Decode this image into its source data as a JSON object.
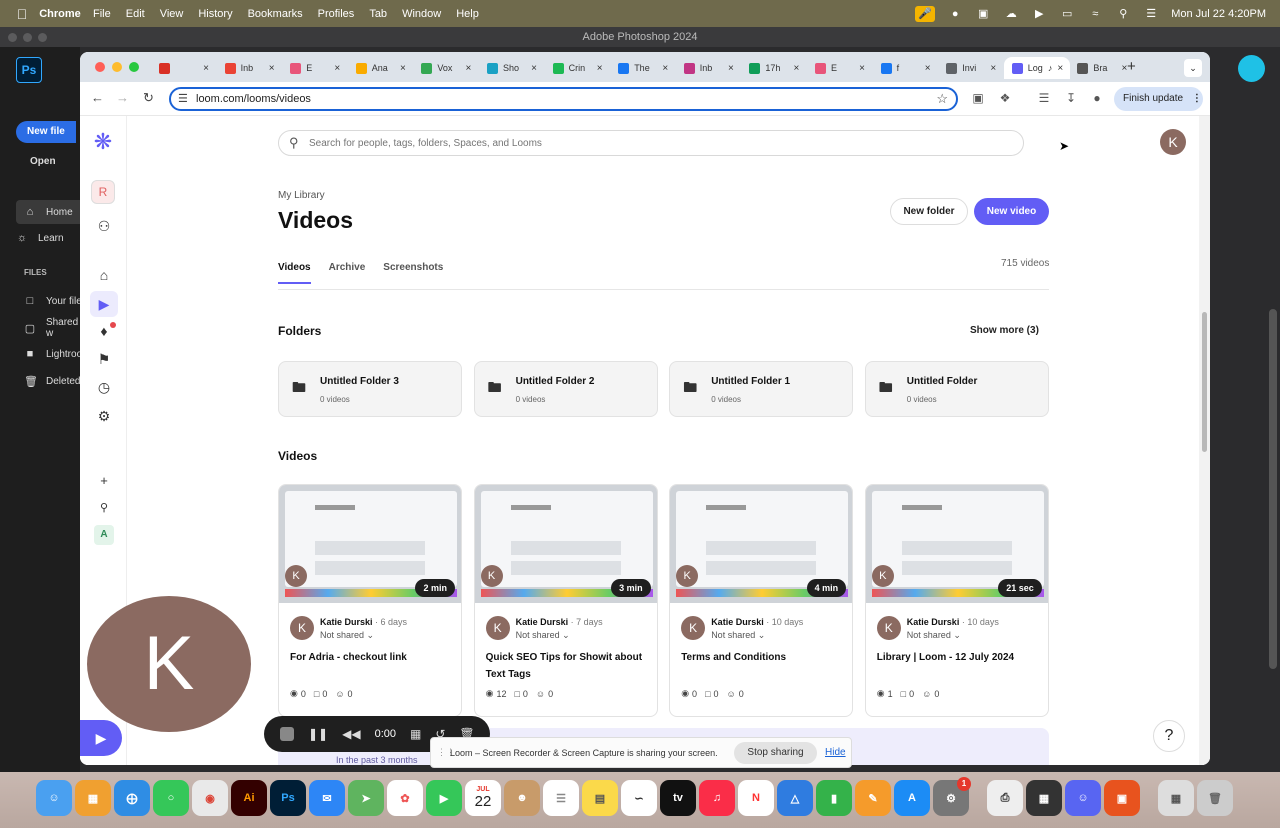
{
  "menubar": {
    "app": "Chrome",
    "items": [
      "File",
      "Edit",
      "View",
      "History",
      "Bookmarks",
      "Profiles",
      "Tab",
      "Window",
      "Help"
    ],
    "clock": "Mon Jul 22  4:20PM"
  },
  "photoshop": {
    "window_title": "Adobe Photoshop 2024",
    "logo": "Ps",
    "new_file": "New file",
    "open": "Open",
    "home": "Home",
    "learn": "Learn",
    "files_header": "FILES",
    "your_files": "Your files",
    "shared": "Shared w",
    "lightroom": "Lightroo",
    "deleted": "Deleted"
  },
  "browser": {
    "tabs": [
      {
        "label": "",
        "color": "#d93025"
      },
      {
        "label": "Inb",
        "color": "#ea4335"
      },
      {
        "label": "E",
        "color": "#e8557a"
      },
      {
        "label": "Ana",
        "color": "#f9ab00"
      },
      {
        "label": "Vox",
        "color": "#34a853"
      },
      {
        "label": "Sho",
        "color": "#1aa1c4"
      },
      {
        "label": "Crin",
        "color": "#1db954"
      },
      {
        "label": "The",
        "color": "#1877f2"
      },
      {
        "label": "Inb",
        "color": "#c13584"
      },
      {
        "label": "17h",
        "color": "#0f9d58"
      },
      {
        "label": "E",
        "color": "#e8557a"
      },
      {
        "label": "f",
        "color": "#1877f2"
      },
      {
        "label": "Invi",
        "color": "#5f6368"
      },
      {
        "label": "Log",
        "color": "#625df5"
      },
      {
        "label": "Bra",
        "color": "#555555"
      }
    ],
    "url": "loom.com/looms/videos",
    "finish_update": "Finish update"
  },
  "loom": {
    "search_placeholder": "Search for people, tags, folders, Spaces, and Looms",
    "user_initial": "K",
    "workspace_initial": "R",
    "breadcrumb": "My Library",
    "title": "Videos",
    "new_folder": "New folder",
    "new_video": "New video",
    "tabs": [
      "Videos",
      "Archive",
      "Screenshots"
    ],
    "video_count": "715 videos",
    "folders_heading": "Folders",
    "show_more": "Show more (3)",
    "folders": [
      {
        "name": "Untitled Folder 3",
        "count": "0 videos"
      },
      {
        "name": "Untitled Folder 2",
        "count": "0 videos"
      },
      {
        "name": "Untitled Folder 1",
        "count": "0 videos"
      },
      {
        "name": "Untitled Folder",
        "count": "0 videos"
      }
    ],
    "videos_heading": "Videos",
    "videos": [
      {
        "duration": "2 min",
        "author": "Katie Durski",
        "age": "6 days",
        "shared": "Not shared",
        "title": "For Adria - checkout link",
        "views": "0",
        "comments": "0",
        "reactions": "0"
      },
      {
        "duration": "3 min",
        "author": "Katie Durski",
        "age": "7 days",
        "shared": "Not shared",
        "title": "Quick SEO Tips for Showit about Text Tags",
        "views": "12",
        "comments": "0",
        "reactions": "0"
      },
      {
        "duration": "4 min",
        "author": "Katie Durski",
        "age": "10 days",
        "shared": "Not shared",
        "title": "Terms and Conditions",
        "views": "0",
        "comments": "0",
        "reactions": "0"
      },
      {
        "duration": "21 sec",
        "author": "Katie Durski",
        "age": "10 days",
        "shared": "Not shared",
        "title": "Library | Loom - 12 July 2024",
        "views": "1",
        "comments": "0",
        "reactions": "0"
      }
    ],
    "promo_text": "In the past 3 months",
    "help": "?"
  },
  "recorder": {
    "camera_initial": "K",
    "timer": "0:00",
    "share_message": "Loom – Screen Recorder & Screen Capture is sharing your screen.",
    "stop_sharing": "Stop sharing",
    "hide": "Hide"
  },
  "dock": {
    "calendar_month": "JUL",
    "calendar_day": "22",
    "badge": "1"
  },
  "colors": {
    "accent": "#625df5",
    "avatar": "#8b6a61"
  }
}
